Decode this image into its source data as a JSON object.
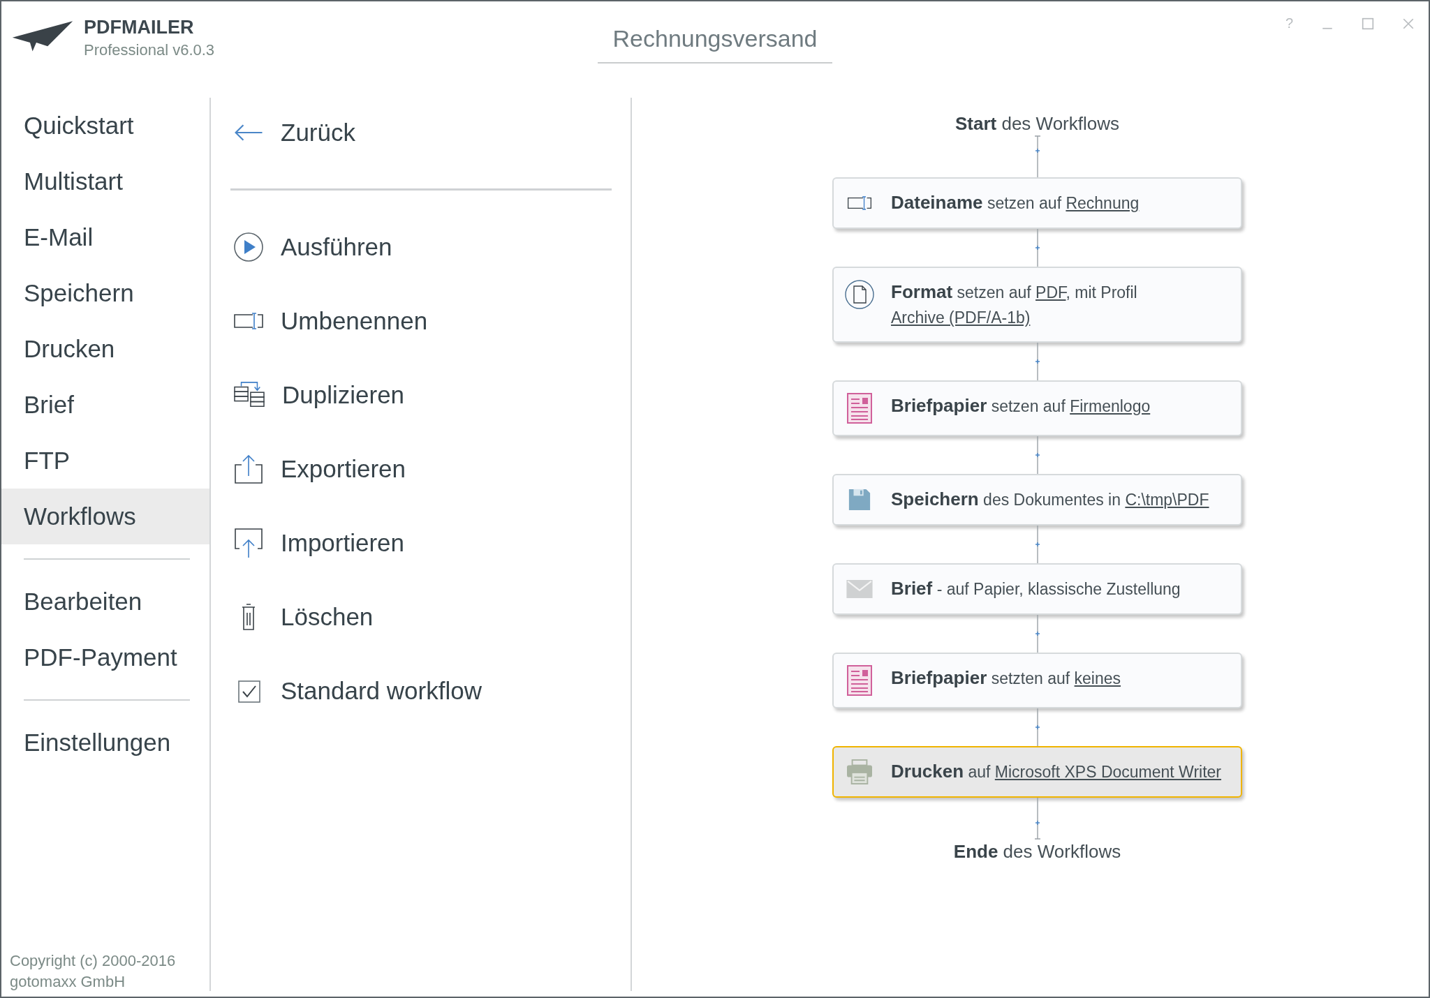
{
  "app": {
    "name": "PDFMAILER",
    "edition": "Professional v6.0.3"
  },
  "title": "Rechnungsversand",
  "window_controls": [
    {
      "kind": "help",
      "label": "?"
    },
    {
      "kind": "minimize"
    },
    {
      "kind": "maximize"
    },
    {
      "kind": "close"
    }
  ],
  "nav": {
    "groups": [
      [
        {
          "label": "Quickstart",
          "selected": false
        },
        {
          "label": "Multistart",
          "selected": false
        },
        {
          "label": "E-Mail",
          "selected": false
        },
        {
          "label": "Speichern",
          "selected": false
        },
        {
          "label": "Drucken",
          "selected": false
        },
        {
          "label": "Brief",
          "selected": false
        },
        {
          "label": "FTP",
          "selected": false
        },
        {
          "label": "Workflows",
          "selected": true
        }
      ],
      [
        {
          "label": "Bearbeiten",
          "selected": false
        },
        {
          "label": "PDF-Payment",
          "selected": false
        }
      ],
      [
        {
          "label": "Einstellungen",
          "selected": false
        }
      ]
    ]
  },
  "copyright": [
    "Copyright (c) 2000-2016",
    "gotomaxx GmbH"
  ],
  "back": {
    "label": "Zurück"
  },
  "actions": [
    {
      "kind": "run",
      "label": "Ausführen"
    },
    {
      "kind": "rename",
      "label": "Umbenennen"
    },
    {
      "kind": "duplicate",
      "label": "Duplizieren"
    },
    {
      "kind": "export",
      "label": "Exportieren"
    },
    {
      "kind": "import",
      "label": "Importieren"
    },
    {
      "kind": "delete",
      "label": "Löschen"
    },
    {
      "kind": "checkbox",
      "label": "Standard workflow",
      "checked": true
    }
  ],
  "flow": {
    "start": "**Start** des Workflows",
    "end": "**Ende** des Workflows",
    "steps": [
      {
        "kind": "rename",
        "selected": false,
        "parts": [
          {
            "kind": "bold",
            "text": "Dateiname"
          },
          {
            "kind": "plain",
            "text": " setzen auf "
          },
          {
            "kind": "link",
            "text": "Rechnung"
          }
        ]
      },
      {
        "kind": "format",
        "selected": false,
        "parts": [
          {
            "kind": "bold",
            "text": "Format"
          },
          {
            "kind": "plain",
            "text": " setzen auf "
          },
          {
            "kind": "link",
            "text": "PDF"
          },
          {
            "kind": "plain",
            "text": ", mit Profil "
          },
          {
            "kind": "link",
            "text": "Archive (PDF/A-1b)"
          }
        ]
      },
      {
        "kind": "letterhead",
        "selected": false,
        "parts": [
          {
            "kind": "bold",
            "text": "Briefpapier"
          },
          {
            "kind": "plain",
            "text": " setzen auf "
          },
          {
            "kind": "link",
            "text": "Firmenlogo"
          }
        ]
      },
      {
        "kind": "save",
        "selected": false,
        "parts": [
          {
            "kind": "bold",
            "text": "Speichern"
          },
          {
            "kind": "plain",
            "text": " des Dokumentes in "
          },
          {
            "kind": "link",
            "text": "C:\\tmp\\PDF"
          }
        ]
      },
      {
        "kind": "letter",
        "selected": false,
        "parts": [
          {
            "kind": "bold",
            "text": "Brief"
          },
          {
            "kind": "plain",
            "text": " - auf Papier, klassische Zustellung"
          }
        ]
      },
      {
        "kind": "letterhead",
        "selected": false,
        "parts": [
          {
            "kind": "bold",
            "text": "Briefpapier"
          },
          {
            "kind": "plain",
            "text": " setzten auf "
          },
          {
            "kind": "link",
            "text": "keines"
          }
        ]
      },
      {
        "kind": "print",
        "selected": true,
        "parts": [
          {
            "kind": "bold",
            "text": "Drucken"
          },
          {
            "kind": "plain",
            "text": " auf "
          },
          {
            "kind": "link",
            "text": "Microsoft XPS Document Writer"
          }
        ]
      }
    ]
  }
}
